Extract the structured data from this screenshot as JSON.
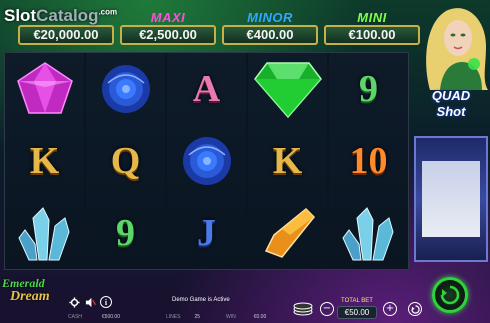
{
  "watermark": {
    "part1": "Slot",
    "part2": "Catalog",
    "com": ".com"
  },
  "jackpots": [
    {
      "name": "",
      "value": "€20,000.00"
    },
    {
      "name": "MAXI",
      "value": "€2,500.00"
    },
    {
      "name": "MINOR",
      "value": "€400.00"
    },
    {
      "name": "MINI",
      "value": "€100.00"
    }
  ],
  "reels": [
    [
      {
        "type": "gem",
        "icon": "pink-diamond-icon",
        "color": "#d83ad8"
      },
      {
        "type": "letter",
        "text": "K",
        "style": "",
        "icon": "king-card-icon"
      },
      {
        "type": "gem",
        "icon": "crystal-cluster-icon",
        "color": "#8ae0f0"
      }
    ],
    [
      {
        "type": "gem",
        "icon": "blue-rose-icon",
        "color": "#2a5ad8"
      },
      {
        "type": "letter",
        "text": "Q",
        "style": "",
        "icon": "queen-card-icon"
      },
      {
        "type": "letter",
        "text": "9",
        "style": "green",
        "icon": "nine-card-icon"
      }
    ],
    [
      {
        "type": "letter",
        "text": "A",
        "style": "pink",
        "icon": "ace-card-icon"
      },
      {
        "type": "gem",
        "icon": "blue-rose-icon",
        "color": "#2a5ad8"
      },
      {
        "type": "letter",
        "text": "J",
        "style": "blue",
        "icon": "jack-card-icon"
      }
    ],
    [
      {
        "type": "gem",
        "icon": "emerald-icon",
        "color": "#2ad83a"
      },
      {
        "type": "letter",
        "text": "K",
        "style": "",
        "icon": "king-card-icon"
      },
      {
        "type": "gem",
        "icon": "amber-crystal-icon",
        "color": "#f0a020"
      }
    ],
    [
      {
        "type": "letter",
        "text": "9",
        "style": "green",
        "icon": "nine-card-icon"
      },
      {
        "type": "letter",
        "text": "10",
        "style": "orange",
        "icon": "ten-card-icon"
      },
      {
        "type": "gem",
        "icon": "crystal-cluster-icon",
        "color": "#8ae0f0"
      }
    ]
  ],
  "quad_shot": {
    "line1": "QUAD",
    "line2": "Shot"
  },
  "game_logo": {
    "line1": "Emerald",
    "line2": "Dream"
  },
  "status_message": "Demo Game is Active",
  "info": {
    "cash_label": "CASH",
    "cash_value": "€500.00",
    "lines_label": "LINES",
    "lines_value": "25",
    "win_label": "WIN",
    "win_value": "€0.00"
  },
  "total_bet": {
    "label": "TOTAL BET",
    "value": "€50.00"
  },
  "buttons": {
    "minus": "−",
    "plus": "+"
  },
  "colors": {
    "spin_accent": "#2fd23a",
    "jackpot_border": "#c7b04a"
  }
}
